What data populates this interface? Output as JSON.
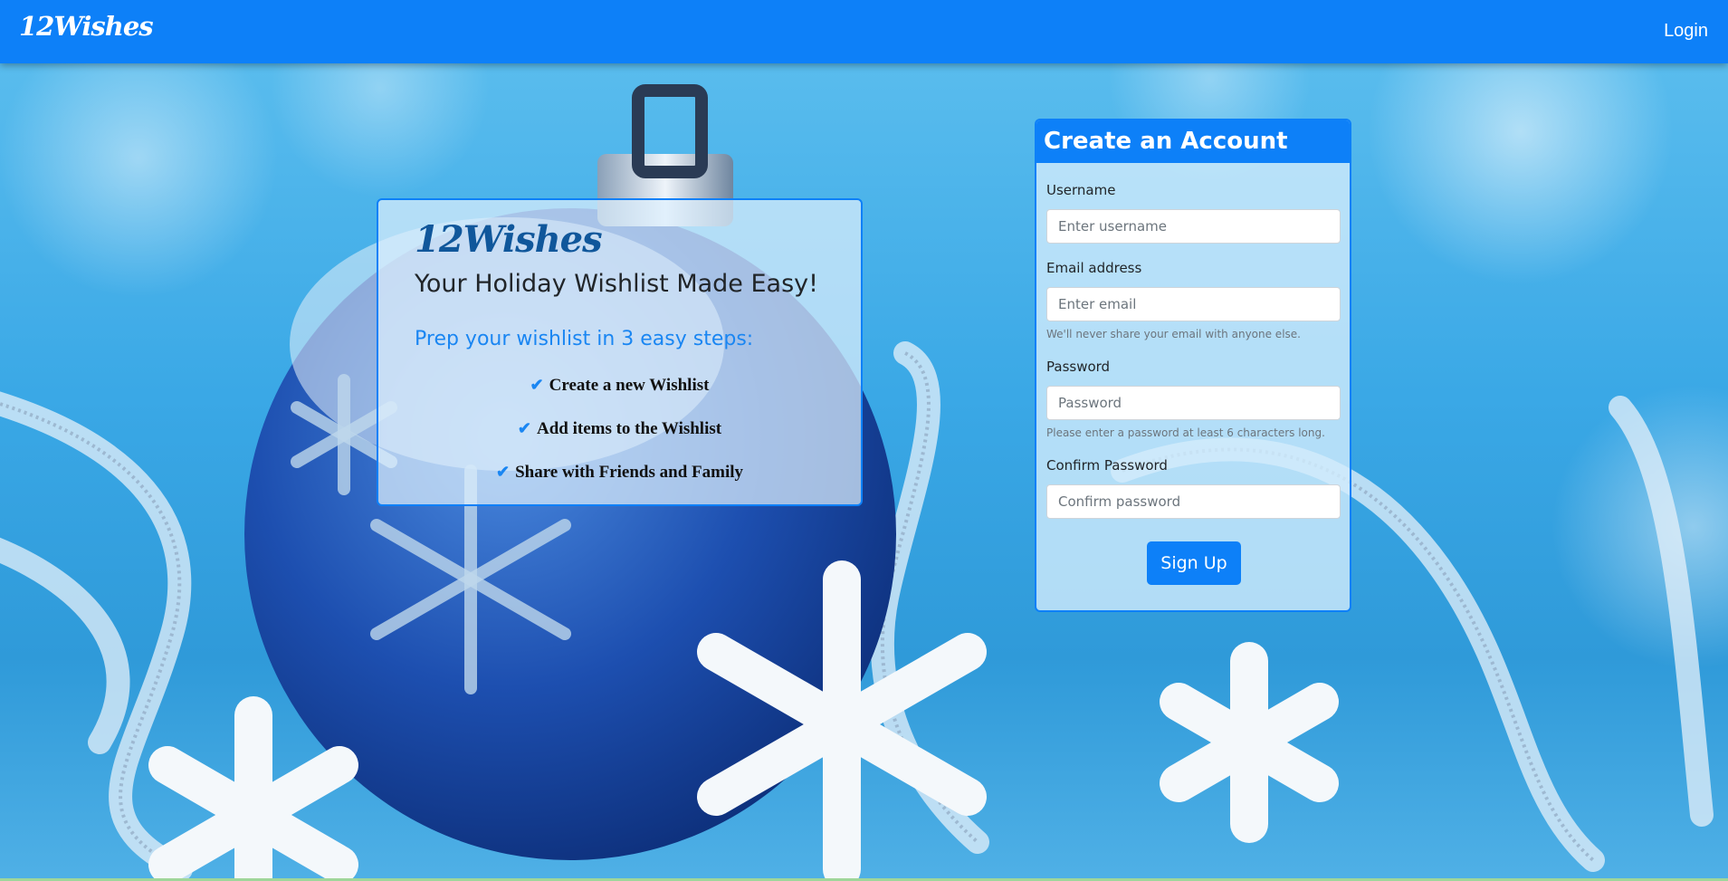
{
  "navbar": {
    "brand": "12Wishes",
    "login": "Login"
  },
  "hero": {
    "logo": "12Wishes",
    "title": "Your Holiday Wishlist Made Easy!",
    "subtitle": "Prep your wishlist in 3 easy steps:",
    "steps": [
      "Create a new Wishlist",
      "Add items to the Wishlist",
      "Share with Friends and Family"
    ],
    "step_icon": "check-icon"
  },
  "signup": {
    "title": "Create an Account",
    "username": {
      "label": "Username",
      "placeholder": "Enter username"
    },
    "email": {
      "label": "Email address",
      "placeholder": "Enter email",
      "help": "We'll never share your email with anyone else."
    },
    "password": {
      "label": "Password",
      "placeholder": "Password",
      "help": "Please enter a password at least 6 characters long."
    },
    "confirm": {
      "label": "Confirm Password",
      "placeholder": "Confirm password"
    },
    "submit": "Sign Up"
  },
  "colors": {
    "primary": "#0d80f8",
    "accent_text": "#1a86f2",
    "logo_dark": "#10579b"
  }
}
